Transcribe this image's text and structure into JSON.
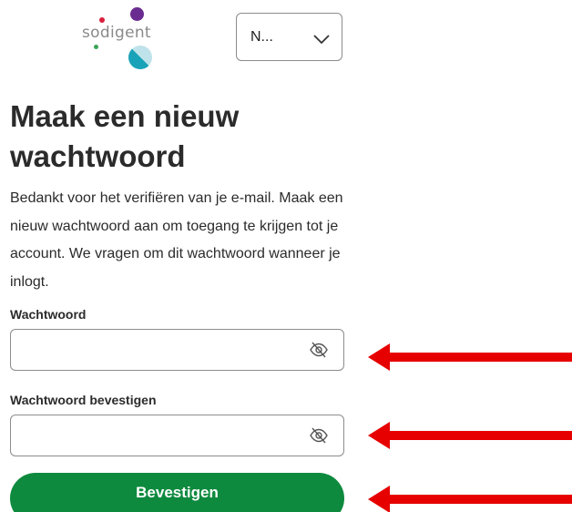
{
  "logo": {
    "text": "sodigent",
    "icon": "sodigent-logo"
  },
  "language": {
    "selected": "N...",
    "icon": "chevron-down-icon"
  },
  "title": "Maak een nieuw wachtwoord",
  "description": "Bedankt voor het verifiëren van je e-mail. Maak een nieuw wachtwoord aan om toegang te krijgen tot je account. We vragen om dit wachtwoord wanneer je inlogt.",
  "fields": {
    "password": {
      "label": "Wachtwoord",
      "value": "",
      "icon": "eye-slash-icon"
    },
    "confirm": {
      "label": "Wachtwoord bevestigen",
      "value": "",
      "icon": "eye-slash-icon"
    }
  },
  "submit_label": "Bevestigen",
  "colors": {
    "primary": "#0e8a3e",
    "annotation_arrow": "#e60000"
  }
}
